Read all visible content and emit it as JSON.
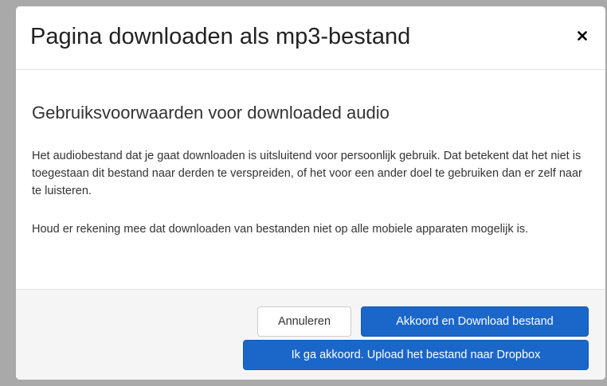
{
  "modal": {
    "title": "Pagina downloaden als mp3-bestand",
    "close_icon": "close-icon",
    "close_glyph": "×"
  },
  "body": {
    "heading": "Gebruiksvoorwaarden voor downloaded audio",
    "paragraphs": [
      "Het audiobestand dat je gaat downloaden is uitsluitend voor persoonlijk gebruik. Dat betekent dat het niet is toegestaan dit bestand naar derden te verspreiden, of het voor een ander doel te gebruiken dan er zelf naar te luisteren.",
      "Houd er rekening mee dat downloaden van bestanden niet op alle mobiele apparaten mogelijk is."
    ]
  },
  "footer": {
    "cancel_label": "Annuleren",
    "accept_download_label": "Akkoord en Download bestand",
    "accept_dropbox_label": "Ik ga akkoord. Upload het bestand naar Dropbox"
  },
  "colors": {
    "backdrop": "#a9a9a9",
    "primary_button": "#1a66c9",
    "footer_background": "#f5f5f5"
  }
}
